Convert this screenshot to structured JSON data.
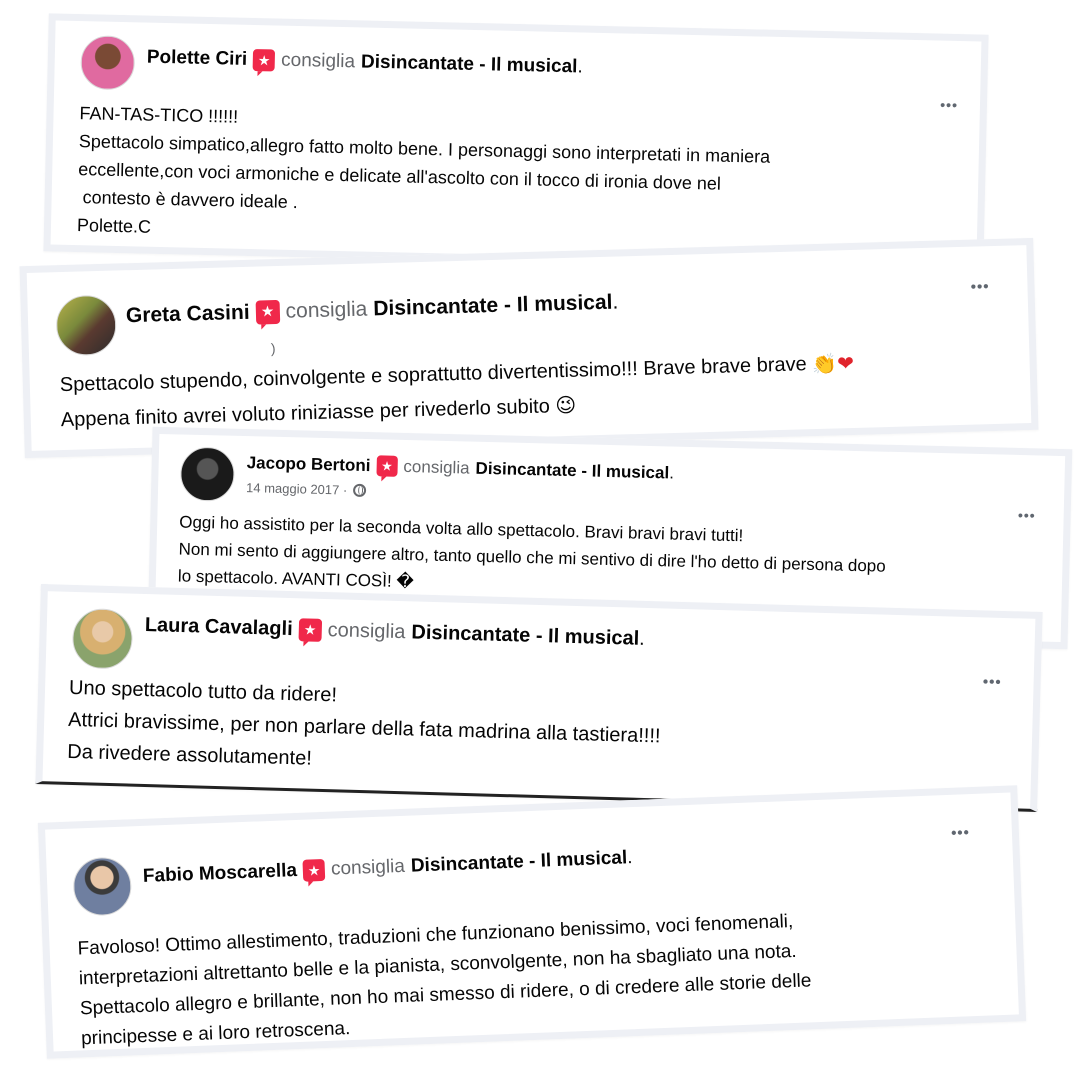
{
  "page_name": "Disincantate - Il musical",
  "page_suffix": ".",
  "verb": "consiglia",
  "more_label": "•••",
  "reviews": [
    {
      "name": "Polette Ciri",
      "lines": [
        "FAN-TAS-TICO !!!!!!",
        "Spettacolo simpatico,allegro fatto molto bene. I personaggi sono interpretati in maniera",
        "eccellente,con voci armoniche e delicate all'ascolto con il tocco di ironia dove nel",
        " contesto è davvero ideale .",
        "Polette.C"
      ]
    },
    {
      "name": "Greta Casini",
      "meta_fragment": ")",
      "lines": [
        "Spettacolo stupendo, coinvolgente e soprattutto divertentissimo!!! Brave brave brave",
        "Appena finito avrei voluto riniziasse per rivederlo subito"
      ]
    },
    {
      "name": "Jacopo Bertoni",
      "date": "14 maggio 2017 ·",
      "lines": [
        "Oggi ho assistito per la seconda volta allo spettacolo. Bravi bravi bravi tutti!",
        "Non mi sento di aggiungere altro, tanto quello che mi sentivo di dire l'ho detto di persona dopo",
        "lo spettacolo. AVANTI COSÌ! �"
      ]
    },
    {
      "name": "Laura Cavalagli",
      "lines": [
        "Uno spettacolo tutto da ridere!",
        "Attrici bravissime, per non parlare della fata madrina alla tastiera!!!!",
        "Da rivedere assolutamente!"
      ]
    },
    {
      "name": "Fabio Moscarella",
      "lines": [
        "Favoloso! Ottimo allestimento, traduzioni che funzionano benissimo, voci fenomenali,",
        "interpretazioni altrettanto belle e la pianista, sconvolgente, non ha sbagliato una nota.",
        "Spettacolo allegro e brillante, non ho mai smesso di ridere, o di credere alle storie delle",
        "principesse e ai loro retroscena."
      ]
    }
  ],
  "colors": {
    "recommend_icon": "#f0284a",
    "muted_text": "#65676b",
    "card_border": "#eef0f5"
  }
}
